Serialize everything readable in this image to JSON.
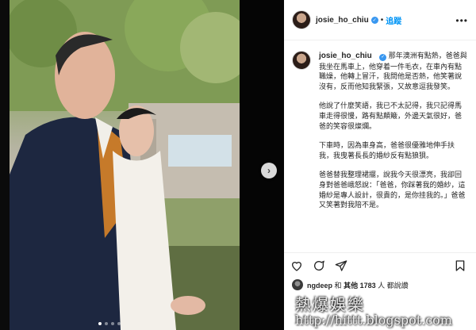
{
  "post": {
    "username": "josie_ho_chiu",
    "separator": "•",
    "follow_label": "追蹤",
    "more_icon": "more-options-icon",
    "caption_intro": "那年澳洲有點熱，爸爸與我坐在馬車上，他穿着一件毛衣，在車內有點職燥，他轉上冒汗，我問他是否熱，他笑著說沒有，反而他知我緊張，又故意逗我發笑。",
    "caption_paragraphs": [
      "他說了什麼笑語，我已不太記得，我只記得馬車走得很慢，路有點顛簸，外邊天氣很好，爸爸的笑容很燦爛。",
      "下車時，因為車身高，爸爸很優雅地伸手扶我，我曳著長長的婚紗反有點狼狽。",
      "爸爸替我整理裙擺，說我今天很漂亮，我卻回身對爸爸峨怒說：「爸爸，你踩著我的婚紗，這婚紗是專人設計，很貴的，是你挂我的。」爸爸又笑著對我陪不是。"
    ],
    "likes": {
      "user": "ngdeep",
      "and_label": "和",
      "others_prefix": "其他",
      "count": "1783",
      "suffix": "人 都說讚"
    }
  },
  "watermark": {
    "title": "熱爆娛樂",
    "url": "http://hittt.blogspot.com"
  },
  "icons": {
    "like": "heart-icon",
    "comment": "comment-icon",
    "share": "share-icon",
    "save": "bookmark-icon",
    "next": "chevron-right-icon"
  },
  "colors": {
    "accent": "#0095f6",
    "verified": "#3897f0"
  }
}
